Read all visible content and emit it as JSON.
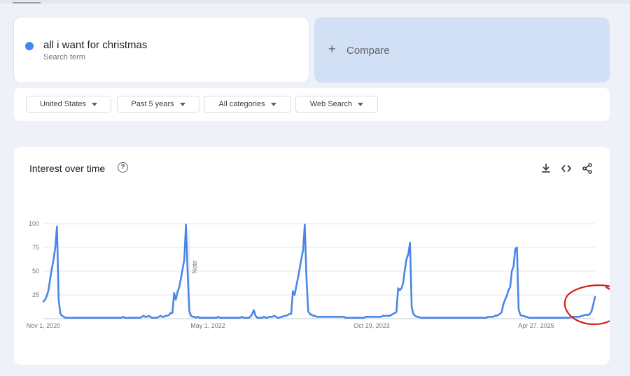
{
  "search": {
    "term": "all i want for christmas",
    "term_caption": "Search term",
    "term_color": "#4285f4",
    "compare_label": "Compare",
    "compare_icon": "plus-icon"
  },
  "filters": [
    {
      "label": "United States"
    },
    {
      "label": "Past 5 years"
    },
    {
      "label": "All categories"
    },
    {
      "label": "Web Search"
    }
  ],
  "card": {
    "title": "Interest over time",
    "help_icon": "help-circle-icon",
    "actions": [
      "download-icon",
      "embed-code-icon",
      "share-icon"
    ]
  },
  "chart_data": {
    "type": "line",
    "yticks": [
      25,
      50,
      75,
      100
    ],
    "ylim": [
      0,
      100
    ],
    "grid": true,
    "x_tick_labels": [
      "Nov 1, 2020",
      "May 1, 2022",
      "Oct 29, 2023",
      "Apr 27, 2025"
    ],
    "note_label": "Note",
    "line_color": "#4a86e8",
    "annotation_color": "#d21f1f",
    "series": [
      {
        "values": [
          18,
          20,
          24,
          30,
          42,
          53,
          62,
          75,
          97,
          20,
          5,
          3,
          2,
          1,
          1,
          1,
          1,
          1,
          1,
          1,
          1,
          1,
          1,
          1,
          1,
          1,
          1,
          1,
          1,
          1,
          1,
          1,
          1,
          1,
          1,
          1,
          1,
          1,
          1,
          1,
          1,
          1,
          1,
          1,
          1,
          1,
          1,
          2,
          1,
          1,
          1,
          1,
          1,
          1,
          1,
          1,
          1,
          1,
          2,
          3,
          2,
          2,
          3,
          2,
          1,
          1,
          1,
          1,
          2,
          3,
          2,
          2,
          3,
          3,
          4,
          6,
          6,
          27,
          20,
          28,
          33,
          42,
          52,
          62,
          99,
          48,
          8,
          3,
          2,
          2,
          1,
          2,
          1,
          1,
          1,
          1,
          1,
          1,
          1,
          1,
          1,
          1,
          1,
          2,
          1,
          1,
          1,
          1,
          1,
          1,
          1,
          1,
          1,
          1,
          1,
          1,
          1,
          2,
          1,
          1,
          1,
          1,
          2,
          5,
          9,
          3,
          1,
          1,
          1,
          1,
          2,
          1,
          1,
          2,
          2,
          2,
          3,
          2,
          1,
          1,
          2,
          2,
          3,
          3,
          4,
          5,
          5,
          29,
          25,
          34,
          43,
          53,
          63,
          72,
          99,
          43,
          8,
          5,
          4,
          3,
          3,
          2,
          2,
          2,
          2,
          2,
          2,
          2,
          2,
          2,
          2,
          2,
          2,
          2,
          2,
          2,
          2,
          2,
          1,
          1,
          1,
          1,
          1,
          1,
          1,
          1,
          1,
          1,
          1,
          1,
          2,
          2,
          2,
          2,
          2,
          2,
          2,
          2,
          2,
          2,
          3,
          3,
          3,
          3,
          3,
          4,
          5,
          6,
          7,
          32,
          30,
          32,
          38,
          52,
          63,
          68,
          80,
          12,
          5,
          3,
          2,
          2,
          1,
          1,
          1,
          1,
          1,
          1,
          1,
          1,
          1,
          1,
          1,
          1,
          1,
          1,
          1,
          1,
          1,
          1,
          1,
          1,
          1,
          1,
          1,
          1,
          1,
          1,
          1,
          1,
          1,
          1,
          1,
          1,
          1,
          1,
          1,
          1,
          1,
          1,
          1,
          1,
          2,
          2,
          2,
          2,
          3,
          3,
          4,
          5,
          7,
          15,
          20,
          24,
          30,
          33,
          50,
          55,
          73,
          75,
          10,
          4,
          3,
          3,
          2,
          2,
          1,
          1,
          1,
          1,
          1,
          1,
          1,
          1,
          1,
          1,
          1,
          1,
          1,
          1,
          1,
          1,
          1,
          1,
          1,
          1,
          1,
          1,
          1,
          1,
          1,
          2,
          2,
          2,
          2,
          2,
          2,
          3,
          3,
          4,
          4,
          4,
          5,
          8,
          15,
          23
        ]
      }
    ]
  }
}
